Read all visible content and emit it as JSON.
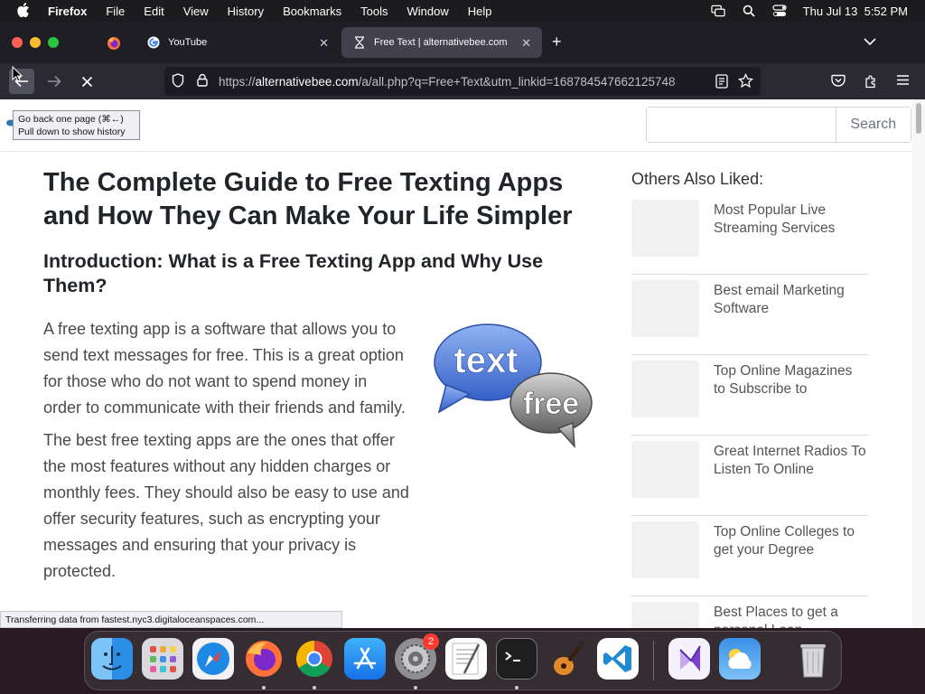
{
  "menubar": {
    "app_name": "Firefox",
    "menus": [
      "File",
      "Edit",
      "View",
      "History",
      "Bookmarks",
      "Tools",
      "Window",
      "Help"
    ],
    "datetime": "Thu Jul 13  5:52 PM"
  },
  "tabs": [
    {
      "title": "YouTube",
      "icon": "google-icon"
    },
    {
      "title": "Free Text | alternativebee.com",
      "icon": "loading-hourglass-icon",
      "active": true
    }
  ],
  "toolbar": {
    "url_prefix": "https://",
    "url_domain": "alternativebee.com",
    "url_rest": "/a/all.php?q=Free+Text&utm_linkid=168784547662125748"
  },
  "tooltip": {
    "line1": "Go back one page (⌘←)",
    "line2": "Pull down to show history"
  },
  "site": {
    "search_placeholder": "",
    "search_button": "Search"
  },
  "article": {
    "title": "The Complete Guide to Free Texting Apps and How They Can Make Your Life Simpler",
    "subtitle": "Introduction: What is a Free Texting App and Why Use Them?",
    "paragraph1": "A free texting app is a software that allows you to send text messages for free. This is a great option for those who do not want to spend money in order to communicate with their friends and family.",
    "paragraph2": "The best free texting apps are the ones that offer the most features without any hidden charges or monthly fees. They should also be easy to use and offer security features, such as encrypting your messages and ensuring that your privacy is protected.",
    "image_text_1": "text",
    "image_text_2": "free"
  },
  "sidebar": {
    "title": "Others Also Liked:",
    "items": [
      "Most Popular Live Streaming Services",
      "Best email Marketing Software",
      "Top Online Magazines to Subscribe to",
      "Great Internet Radios To Listen To Online",
      "Top Online Colleges to get your Degree",
      "Best Places to get a personal Loan"
    ]
  },
  "status_text": "Transferring data from fastest.nyc3.digitaloceanspaces.com...",
  "dock": {
    "apps": [
      "Finder",
      "Launchpad",
      "Safari",
      "Firefox",
      "Chrome",
      "App Store",
      "System Settings",
      "TextEdit",
      "Terminal",
      "GarageBand",
      "Visual Studio Code",
      "Visual Studio",
      "Weather",
      "Trash"
    ],
    "settings_badge": "2"
  }
}
